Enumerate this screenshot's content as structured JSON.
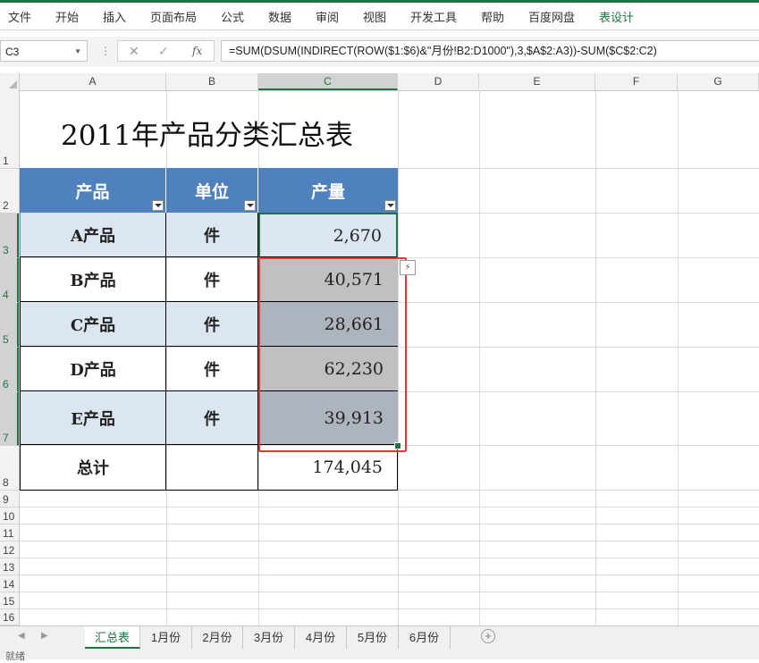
{
  "ribbon": {
    "tabs": [
      "文件",
      "开始",
      "插入",
      "页面布局",
      "公式",
      "数据",
      "审阅",
      "视图",
      "开发工具",
      "帮助",
      "百度网盘",
      "表设计"
    ]
  },
  "formula_bar": {
    "name_box": "C3",
    "fx_icon": "fx",
    "formula": "=SUM(DSUM(INDIRECT(ROW($1:$6)&\"月份!B2:D1000\"),3,$A$2:A3))-SUM($C$2:C2)"
  },
  "columns": [
    "A",
    "B",
    "C",
    "D",
    "E",
    "F",
    "G"
  ],
  "rows": [
    "1",
    "2",
    "3",
    "4",
    "5",
    "6",
    "7",
    "8",
    "9",
    "10",
    "11",
    "12",
    "13",
    "14",
    "15",
    "16"
  ],
  "table": {
    "title": "2011年产品分类汇总表",
    "headers": [
      "产品",
      "单位",
      "产量"
    ],
    "rows": [
      {
        "product": "A产品",
        "unit": "件",
        "qty": "2,670"
      },
      {
        "product": "B产品",
        "unit": "件",
        "qty": "40,571"
      },
      {
        "product": "C产品",
        "unit": "件",
        "qty": "28,661"
      },
      {
        "product": "D产品",
        "unit": "件",
        "qty": "62,230"
      },
      {
        "product": "E产品",
        "unit": "件",
        "qty": "39,913"
      }
    ],
    "total": {
      "label": "总计",
      "unit": "",
      "qty": "174,045"
    }
  },
  "sheet_tabs": [
    "汇总表",
    "1月份",
    "2月份",
    "3月份",
    "4月份",
    "5月份",
    "6月份"
  ],
  "active_sheet": "汇总表",
  "status": "就绪",
  "colors": {
    "accent": "#217346",
    "header_fill": "#4f81bd",
    "band_fill": "#dce6f1",
    "highlight": "#e03a3a"
  }
}
